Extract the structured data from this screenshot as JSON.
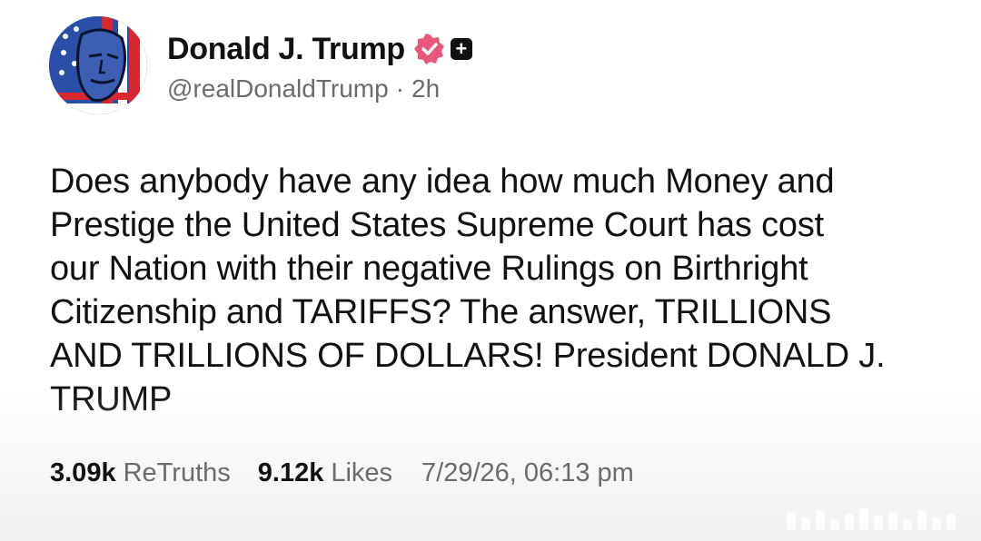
{
  "author": {
    "display_name": "Donald J. Trump",
    "handle": "@realDonaldTrump",
    "separator": "·",
    "time_ago": "2h",
    "verified_icon": "verified-badge-icon",
    "plus_icon": "plus-badge-icon"
  },
  "post": {
    "text": "Does anybody have any idea how much Money and\nPrestige the United States Supreme Court has cost\nour Nation with their negative Rulings on Birthright\nCitizenship and TARIFFS? The answer, TRILLIONS\nAND TRILLIONS OF DOLLARS! President DONALD J.\nTRUMP"
  },
  "stats": {
    "retruths_count": "3.09k",
    "retruths_label": "ReTruths",
    "likes_count": "9.12k",
    "likes_label": "Likes",
    "timestamp": "7/29/26, 06:13 pm"
  },
  "colors": {
    "text": "#111111",
    "muted": "#6b6b6b",
    "verified": "#e8577a",
    "background": "#ffffff"
  }
}
